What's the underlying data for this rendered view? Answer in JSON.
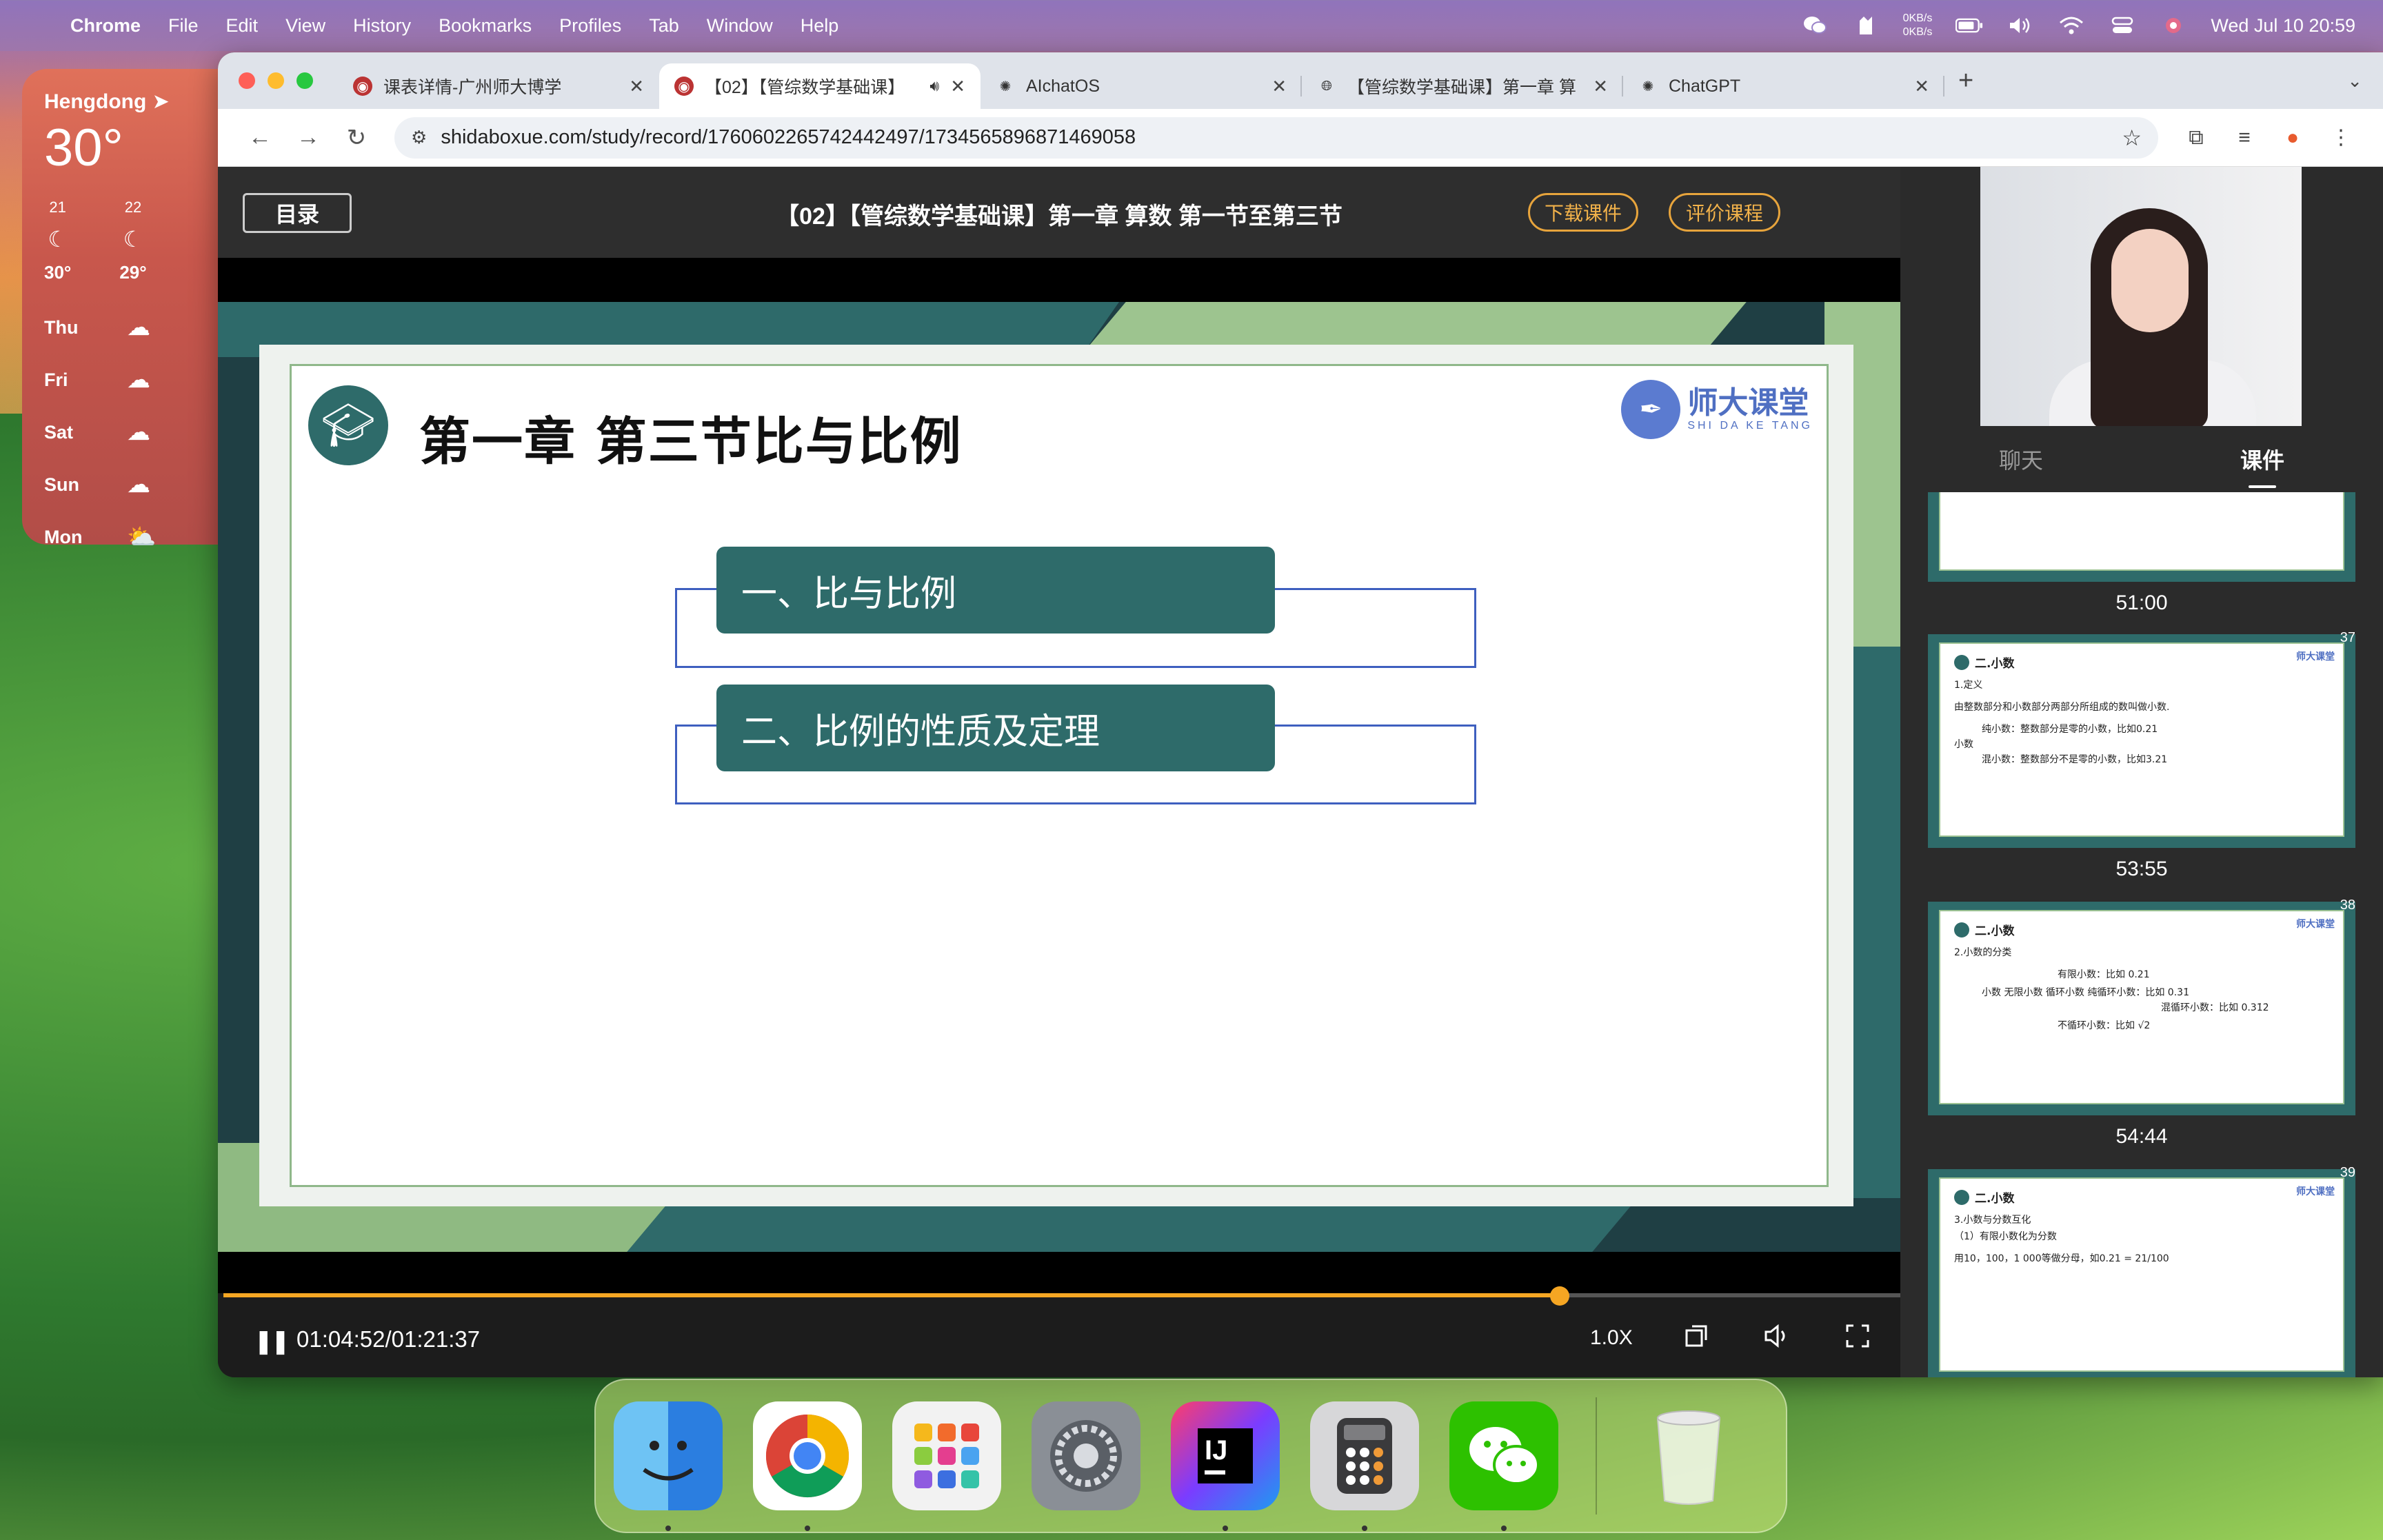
{
  "menubar": {
    "app": "Chrome",
    "items": [
      "File",
      "Edit",
      "View",
      "History",
      "Bookmarks",
      "Profiles",
      "Tab",
      "Window",
      "Help"
    ],
    "net_up": "0KB/s",
    "net_down": "0KB/s",
    "datetime": "Wed Jul 10  20:59"
  },
  "weather": {
    "city": "Hengdong",
    "temp": "30°",
    "hours": [
      {
        "label": "21",
        "temp": "30°"
      },
      {
        "label": "22",
        "temp": "29°"
      }
    ],
    "days": [
      "Thu",
      "Fri",
      "Sat",
      "Sun",
      "Mon"
    ]
  },
  "browser": {
    "tabs": [
      {
        "title": "课表详情-广州师大博学",
        "active": false
      },
      {
        "title": "【02】【管综数学基础课】",
        "active": true
      },
      {
        "title": "AIchatOS",
        "active": false
      },
      {
        "title": "【管综数学基础课】第一章 算",
        "active": false
      },
      {
        "title": "ChatGPT",
        "active": false
      }
    ],
    "url": "shidaboxue.com/study/record/1760602265742442497/1734565896871469058"
  },
  "player": {
    "catalog_label": "目录",
    "course_title": "【02】【管综数学基础课】第一章 算数 第一节至第三节",
    "download_label": "下载课件",
    "rate_label": "评价课程",
    "slide": {
      "heading": "第一章   第三节比与比例",
      "logo_text": "师大课堂",
      "logo_sub": "SHI DA KE TANG",
      "items": [
        "一、比与比例",
        "二、比例的性质及定理"
      ]
    },
    "progress": 0.7967,
    "time": "01:04:52/01:21:37",
    "speed": "1.0X"
  },
  "side_panel": {
    "tabs": [
      "聊天",
      "课件"
    ],
    "active_tab": "课件",
    "thumbs": [
      {
        "num": "",
        "time": "51:00",
        "title": "",
        "lines": []
      },
      {
        "num": "37",
        "time": "53:55",
        "title": "二.小数",
        "lines": [
          "1.定义",
          "由整数部分和小数部分两部分所组成的数叫做小数.",
          "纯小数：整数部分是零的小数，比如0.21",
          "小数",
          "混小数：整数部分不是零的小数，比如3.21"
        ]
      },
      {
        "num": "38",
        "time": "54:44",
        "title": "二.小数",
        "lines": [
          "2.小数的分类",
          "有限小数：比如 0.21",
          "小数  无限小数  循环小数  纯循环小数：比如 0.3̇1̇",
          "混循环小数：比如 0.31̇2̇",
          "不循环小数：比如 √2"
        ]
      },
      {
        "num": "39",
        "time": "",
        "title": "二.小数",
        "lines": [
          "3.小数与分数互化",
          "（1）有限小数化为分数",
          "用10，100，1 000等做分母，如0.21 = 21/100"
        ]
      }
    ]
  },
  "dock": {
    "apps": [
      "finder",
      "chrome",
      "launchpad",
      "system-settings",
      "intellij-idea",
      "calculator",
      "wechat",
      "trash"
    ]
  }
}
